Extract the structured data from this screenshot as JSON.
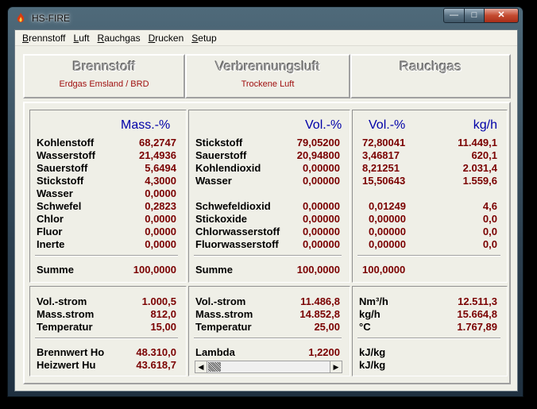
{
  "window": {
    "title": "HS-FIRE",
    "min": "—",
    "max": "□",
    "close": "✕"
  },
  "menu": [
    "Brennstoff",
    "Luft",
    "Rauchgas",
    "Drucken",
    "Setup"
  ],
  "headers": {
    "brennstoff": {
      "title": "Brennstoff",
      "subtitle": "Erdgas Emsland / BRD"
    },
    "luft": {
      "title": "Verbrennungsluft",
      "subtitle": "Trockene Luft"
    },
    "rauchgas": {
      "title": "Rauchgas",
      "subtitle": ""
    }
  },
  "brennstoff": {
    "unit": "Mass.-%",
    "rows": [
      {
        "label": "Kohlenstoff",
        "value": "68,2747"
      },
      {
        "label": "Wasserstoff",
        "value": "21,4936"
      },
      {
        "label": "Sauerstoff",
        "value": "5,6494"
      },
      {
        "label": "Stickstoff",
        "value": "4,3000"
      },
      {
        "label": "Wasser",
        "value": "0,0000"
      },
      {
        "label": "Schwefel",
        "value": "0,2823"
      },
      {
        "label": "Chlor",
        "value": "0,0000"
      },
      {
        "label": "Fluor",
        "value": "0,0000"
      },
      {
        "label": "Inerte",
        "value": "0,0000"
      }
    ],
    "summe_label": "Summe",
    "summe_value": "100,0000",
    "props": [
      {
        "label": "Vol.-strom",
        "value": "1.000,5"
      },
      {
        "label": "Mass.strom",
        "value": "812,0"
      },
      {
        "label": "Temperatur",
        "value": "15,00"
      }
    ],
    "heat": [
      {
        "label": "Brennwert Ho",
        "value": "48.310,0"
      },
      {
        "label": "Heizwert Hu",
        "value": "43.618,7"
      }
    ]
  },
  "luft": {
    "unit": "Vol.-%",
    "rows": [
      {
        "label": "Stickstoff",
        "value": "79,05200"
      },
      {
        "label": "Sauerstoff",
        "value": "20,94800"
      },
      {
        "label": "Kohlendioxid",
        "value": "0,00000"
      },
      {
        "label": "Wasser",
        "value": "0,00000"
      }
    ],
    "rows2": [
      {
        "label": "Schwefeldioxid",
        "value": "0,00000"
      },
      {
        "label": "Stickoxide",
        "value": "0,00000"
      },
      {
        "label": "Chlorwasserstoff",
        "value": "0,00000"
      },
      {
        "label": "Fluorwasserstoff",
        "value": "0,00000"
      }
    ],
    "summe_label": "Summe",
    "summe_value": "100,0000",
    "props": [
      {
        "label": "Vol.-strom",
        "value": "11.486,8"
      },
      {
        "label": "Mass.strom",
        "value": "14.852,8"
      },
      {
        "label": "Temperatur",
        "value": "25,00"
      }
    ],
    "lambda_label": "Lambda",
    "lambda_value": "1,2200",
    "lambda_fraction": 0.0
  },
  "rauchgas": {
    "unit_vol": "Vol.-%",
    "unit_kg": "kg/h",
    "rows": [
      {
        "vol": "72,80041",
        "kg": "11.449,1"
      },
      {
        "vol": "3,46817",
        "kg": "620,1"
      },
      {
        "vol": "8,21251",
        "kg": "2.031,4"
      },
      {
        "vol": "15,50643",
        "kg": "1.559,6"
      }
    ],
    "rows2": [
      {
        "vol": "0,01249",
        "kg": "4,6"
      },
      {
        "vol": "0,00000",
        "kg": "0,0"
      },
      {
        "vol": "0,00000",
        "kg": "0,0"
      },
      {
        "vol": "0,00000",
        "kg": "0,0"
      }
    ],
    "summe_value": "100,0000",
    "props": [
      {
        "label": "Nm³/h",
        "value": "12.511,3"
      },
      {
        "label": "kg/h",
        "value": "15.664,8"
      },
      {
        "label": "°C",
        "value": "1.767,89"
      }
    ],
    "heat_units": [
      "kJ/kg",
      "kJ/kg"
    ]
  }
}
